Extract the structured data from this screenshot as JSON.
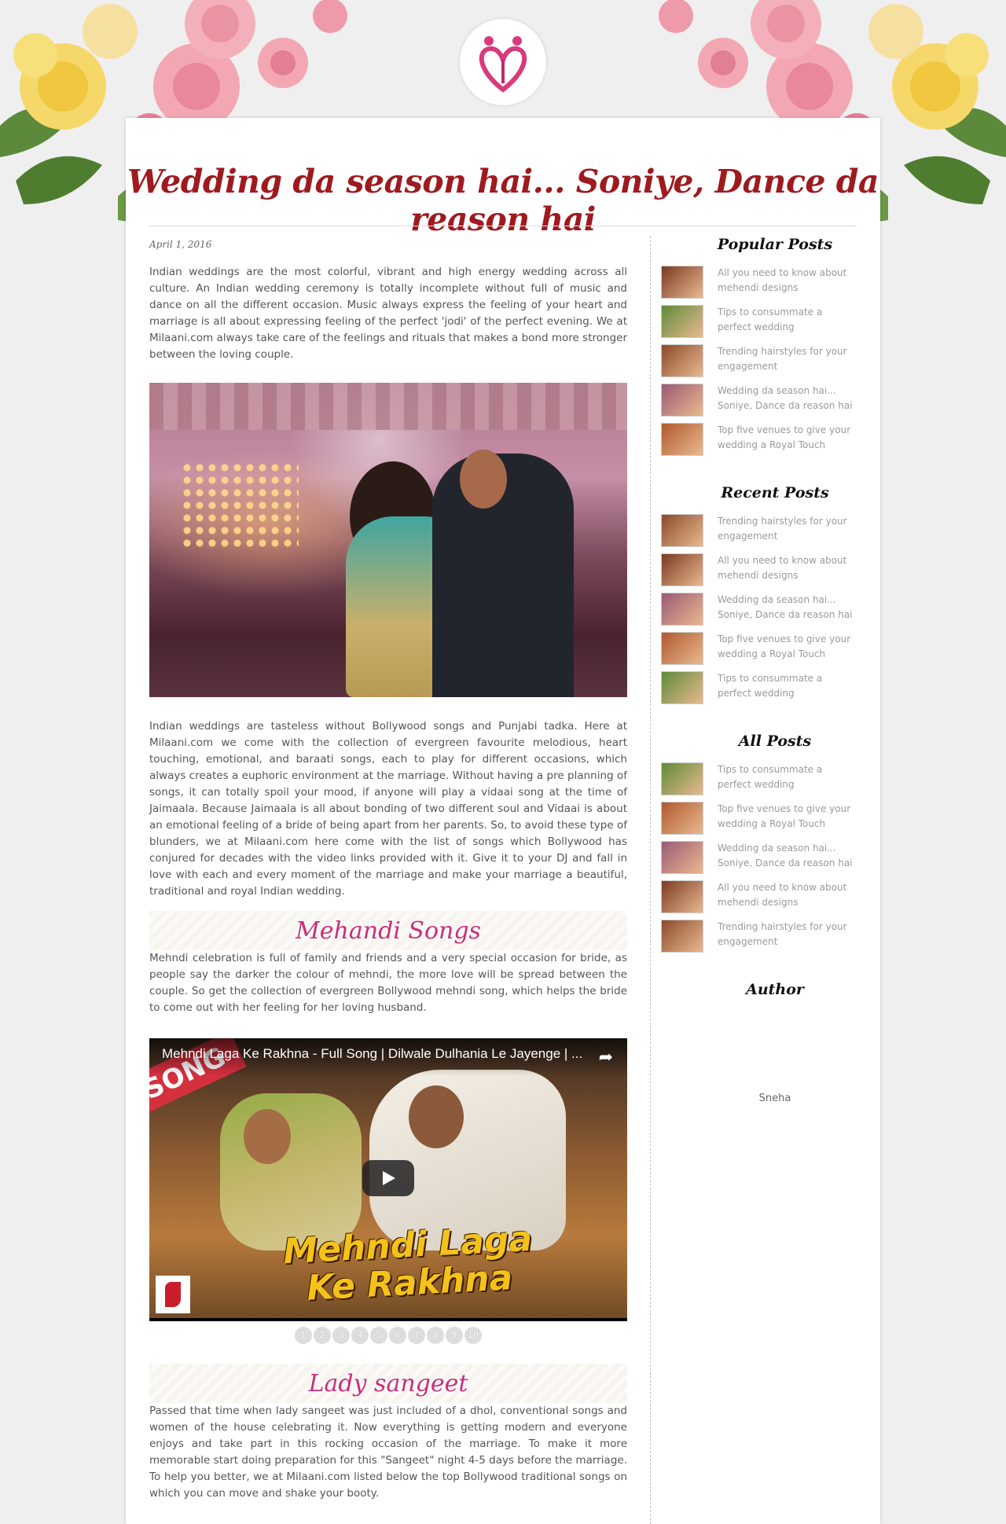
{
  "post": {
    "title": "Wedding da season hai... Soniye, Dance da reason hai",
    "date": "April 1, 2016",
    "intro": "Indian weddings are the most colorful, vibrant and high energy wedding across all culture. An Indian wedding ceremony is totally incomplete without full of music and dance on all the different occasion. Music always express the feeling of your heart and marriage is all about expressing feeling of the perfect 'jodi' of the perfect evening. We at Milaani.com always take care of the feelings and rituals that makes a bond more stronger between the loving couple.",
    "body": "Indian weddings are tasteless without Bollywood songs and Punjabi tadka. Here at Milaani.com we come with the collection of evergreen favourite melodious, heart touching, emotional, and baraati songs, each to play for different occasions, which always creates a euphoric environment at the marriage. Without having a pre planning of songs, it can totally spoil your mood, if anyone will play a vidaai song at the time of Jaimaala. Because Jaimaala is all about bonding of two different soul and Vidaai is about an emotional feeling of a bride of being apart from her parents. So, to avoid these type of blunders, we at Milaani.com here come with the list of songs which Bollywood has conjured for decades with the video links provided with it. Give it to your DJ and fall in love with each and every moment of the marriage and make your marriage a beautiful, traditional and royal Indian wedding.",
    "mehandi": {
      "heading": "Mehandi Songs",
      "text": "Mehndi celebration is full of family and friends and a very special occasion for bride, as people say the darker the colour of mehndi, the more love will be spread between the couple. So get the collection of evergreen Bollywood mehndi song, which helps the bride to come out with her feeling for her loving husband."
    },
    "video": {
      "title": "Mehndi Laga Ke Rakhna - Full Song | Dilwale Dulhania Le Jayenge | ...",
      "badge": "SONG",
      "overlay_line1": "Mehndi Laga",
      "overlay_line2": "Ke Rakhna",
      "share_icon": "share-arrow-icon",
      "play_icon": "play-icon"
    },
    "pager": [
      "1",
      "2",
      "3",
      "4",
      "5",
      "6",
      "7",
      "8",
      "9",
      "10"
    ],
    "lady_sangeet": {
      "heading": "Lady sangeet",
      "text": "Passed that time when lady sangeet was just included of a dhol, conventional songs and women of the house celebrating it. Now everything is getting modern and everyone enjoys and take part in this rocking occasion of the marriage. To make it more memorable start doing preparation for this \"Sangeet\" night 4-5 days before the marriage. To help you better, we at Milaani.com listed below the top Bollywood traditional songs on which you can move and shake your booty."
    }
  },
  "sidebar": {
    "popular": {
      "title": "Popular Posts",
      "items": [
        {
          "label": "All you need to know about mehendi designs",
          "thumb": "#7a3a22"
        },
        {
          "label": "Tips to consummate a perfect wedding",
          "thumb": "#5f8a3a"
        },
        {
          "label": "Trending hairstyles for your engagement",
          "thumb": "#8a4a2a"
        },
        {
          "label": "Wedding da season hai... Soniye, Dance da reason hai",
          "thumb": "#9a5a74"
        },
        {
          "label": "Top five venues to give your wedding a Royal Touch",
          "thumb": "#b0592e"
        }
      ]
    },
    "recent": {
      "title": "Recent Posts",
      "items": [
        {
          "label": "Trending hairstyles for your engagement",
          "thumb": "#8a4a2a"
        },
        {
          "label": "All you need to know about mehendi designs",
          "thumb": "#7a3a22"
        },
        {
          "label": "Wedding da season hai... Soniye, Dance da reason hai",
          "thumb": "#9a5a74"
        },
        {
          "label": "Top five venues to give your wedding a Royal Touch",
          "thumb": "#b0592e"
        },
        {
          "label": "Tips to consummate a perfect wedding",
          "thumb": "#5f8a3a"
        }
      ]
    },
    "all": {
      "title": "All Posts",
      "items": [
        {
          "label": "Tips to consummate a perfect wedding",
          "thumb": "#5f8a3a"
        },
        {
          "label": "Top five venues to give your wedding a Royal Touch",
          "thumb": "#b0592e"
        },
        {
          "label": "Wedding da season hai... Soniye, Dance da reason hai",
          "thumb": "#9a5a74"
        },
        {
          "label": "All you need to know about mehendi designs",
          "thumb": "#7a3a22"
        },
        {
          "label": "Trending hairstyles for your engagement",
          "thumb": "#8a4a2a"
        }
      ]
    },
    "author": {
      "title": "Author",
      "name": "Sneha"
    }
  },
  "colors": {
    "title": "#9e1a1f",
    "section_heading": "#c6307c",
    "body_text": "#555555",
    "sidebar_link": "#9a9a9a",
    "logo_heart": "#d83a7c"
  }
}
